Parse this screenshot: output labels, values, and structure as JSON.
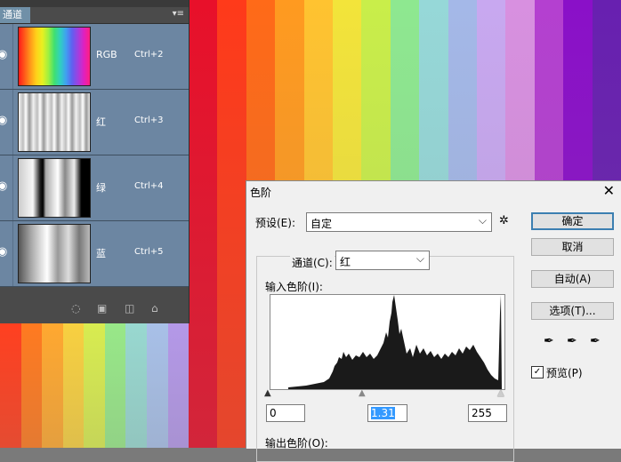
{
  "background": {
    "stripe_colors": [
      "#e8102a",
      "#ff3a1a",
      "#ff6a18",
      "#ff9a20",
      "#ffc330",
      "#f3e43a",
      "#c9ee4a",
      "#8ee890",
      "#96d8d8",
      "#a4b8e8",
      "#c8a8f0",
      "#d890e0",
      "#b440d0",
      "#8a10c8",
      "#6820b0"
    ],
    "bottom_left_colors": [
      "#ff4020",
      "#ff7a20",
      "#ffa830",
      "#f8d040",
      "#d8ec50",
      "#98e888",
      "#98d8d0",
      "#a8c0e8",
      "#b498e8"
    ]
  },
  "channels_panel": {
    "tab_label": "通道",
    "menu_icon": "panel-menu-icon",
    "rows": [
      {
        "name": "RGB",
        "shortcut": "Ctrl+2",
        "thumbnail": "rgb-thumbnail"
      },
      {
        "name": "红",
        "shortcut": "Ctrl+3",
        "thumbnail": "red-channel-thumbnail"
      },
      {
        "name": "绿",
        "shortcut": "Ctrl+4",
        "thumbnail": "green-channel-thumbnail"
      },
      {
        "name": "蓝",
        "shortcut": "Ctrl+5",
        "thumbnail": "blue-channel-thumbnail"
      }
    ],
    "footer_icons": [
      "load-selection-icon",
      "save-selection-icon",
      "new-channel-icon",
      "delete-channel-icon"
    ]
  },
  "levels_dialog": {
    "title": "色阶",
    "preset_label": "预设(E):",
    "preset_value": "自定",
    "channel_label": "通道(C):",
    "channel_value": "红",
    "input_levels_label": "输入色阶(I):",
    "input_values": [
      "0",
      "1.31",
      "255"
    ],
    "output_levels_label": "输出色阶(O):",
    "buttons": {
      "ok": "确定",
      "cancel": "取消",
      "auto": "自动(A)",
      "options": "选项(T)..."
    },
    "preview_label": "预览(P)",
    "preview_checked": true,
    "preview_check_glyph": "✓",
    "gear_icon_glyph": "✲"
  }
}
